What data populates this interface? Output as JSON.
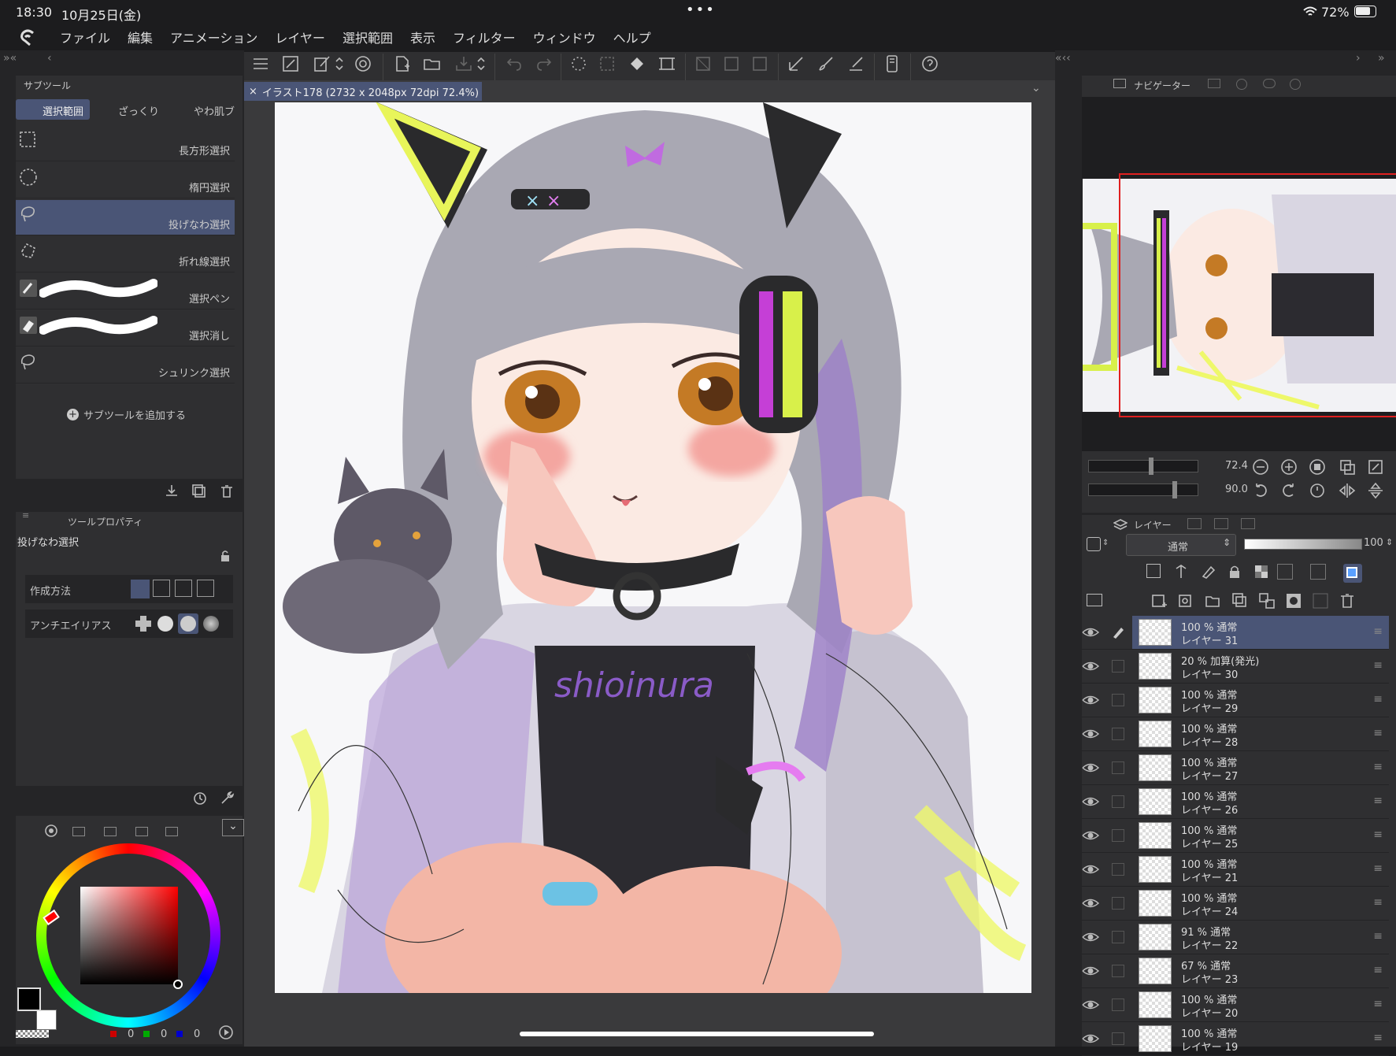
{
  "status": {
    "time": "18:30",
    "date": "10月25日(金)",
    "battery": "72%",
    "dots": "•••"
  },
  "menu": [
    "ファイル",
    "編集",
    "アニメーション",
    "レイヤー",
    "選択範囲",
    "表示",
    "フィルター",
    "ウィンドウ",
    "ヘルプ"
  ],
  "subtool": {
    "title": "サブツール",
    "tabs": [
      "選択範囲",
      "ざっくり",
      "やわ肌ブ"
    ],
    "items": [
      "長方形選択",
      "楕円選択",
      "投げなわ選択",
      "折れ線選択",
      "選択ペン",
      "選択消し",
      "シュリンク選択"
    ],
    "add": "サブツールを追加する"
  },
  "toolprop": {
    "title": "ツールプロパティ",
    "name": "投げなわ選択",
    "method_label": "作成方法",
    "aa_label": "アンチエイリアス"
  },
  "canvas": {
    "tab": "イラスト178 (2732 x 2048px 72dpi 72.4%)"
  },
  "navigator": {
    "title": "ナビゲーター",
    "zoom": "72.4",
    "angle": "90.0"
  },
  "layers": {
    "title": "レイヤー",
    "blend": "通常",
    "opacity": "100",
    "items": [
      {
        "top": "100 %  通常",
        "name": "レイヤー 31"
      },
      {
        "top": "20 %  加算(発光)",
        "name": "レイヤー 30"
      },
      {
        "top": "100 %  通常",
        "name": "レイヤー 29"
      },
      {
        "top": "100 %  通常",
        "name": "レイヤー 28"
      },
      {
        "top": "100 %  通常",
        "name": "レイヤー 27"
      },
      {
        "top": "100 %  通常",
        "name": "レイヤー 26"
      },
      {
        "top": "100 %  通常",
        "name": "レイヤー 25"
      },
      {
        "top": "100 %  通常",
        "name": "レイヤー 21"
      },
      {
        "top": "100 %  通常",
        "name": "レイヤー 24"
      },
      {
        "top": "91 %  通常",
        "name": "レイヤー 22"
      },
      {
        "top": "67 %  通常",
        "name": "レイヤー 23"
      },
      {
        "top": "100 %  通常",
        "name": "レイヤー 20"
      },
      {
        "top": "100 %  通常",
        "name": "レイヤー 19"
      }
    ]
  },
  "color": {
    "r": "0",
    "g": "0",
    "b": "0"
  }
}
